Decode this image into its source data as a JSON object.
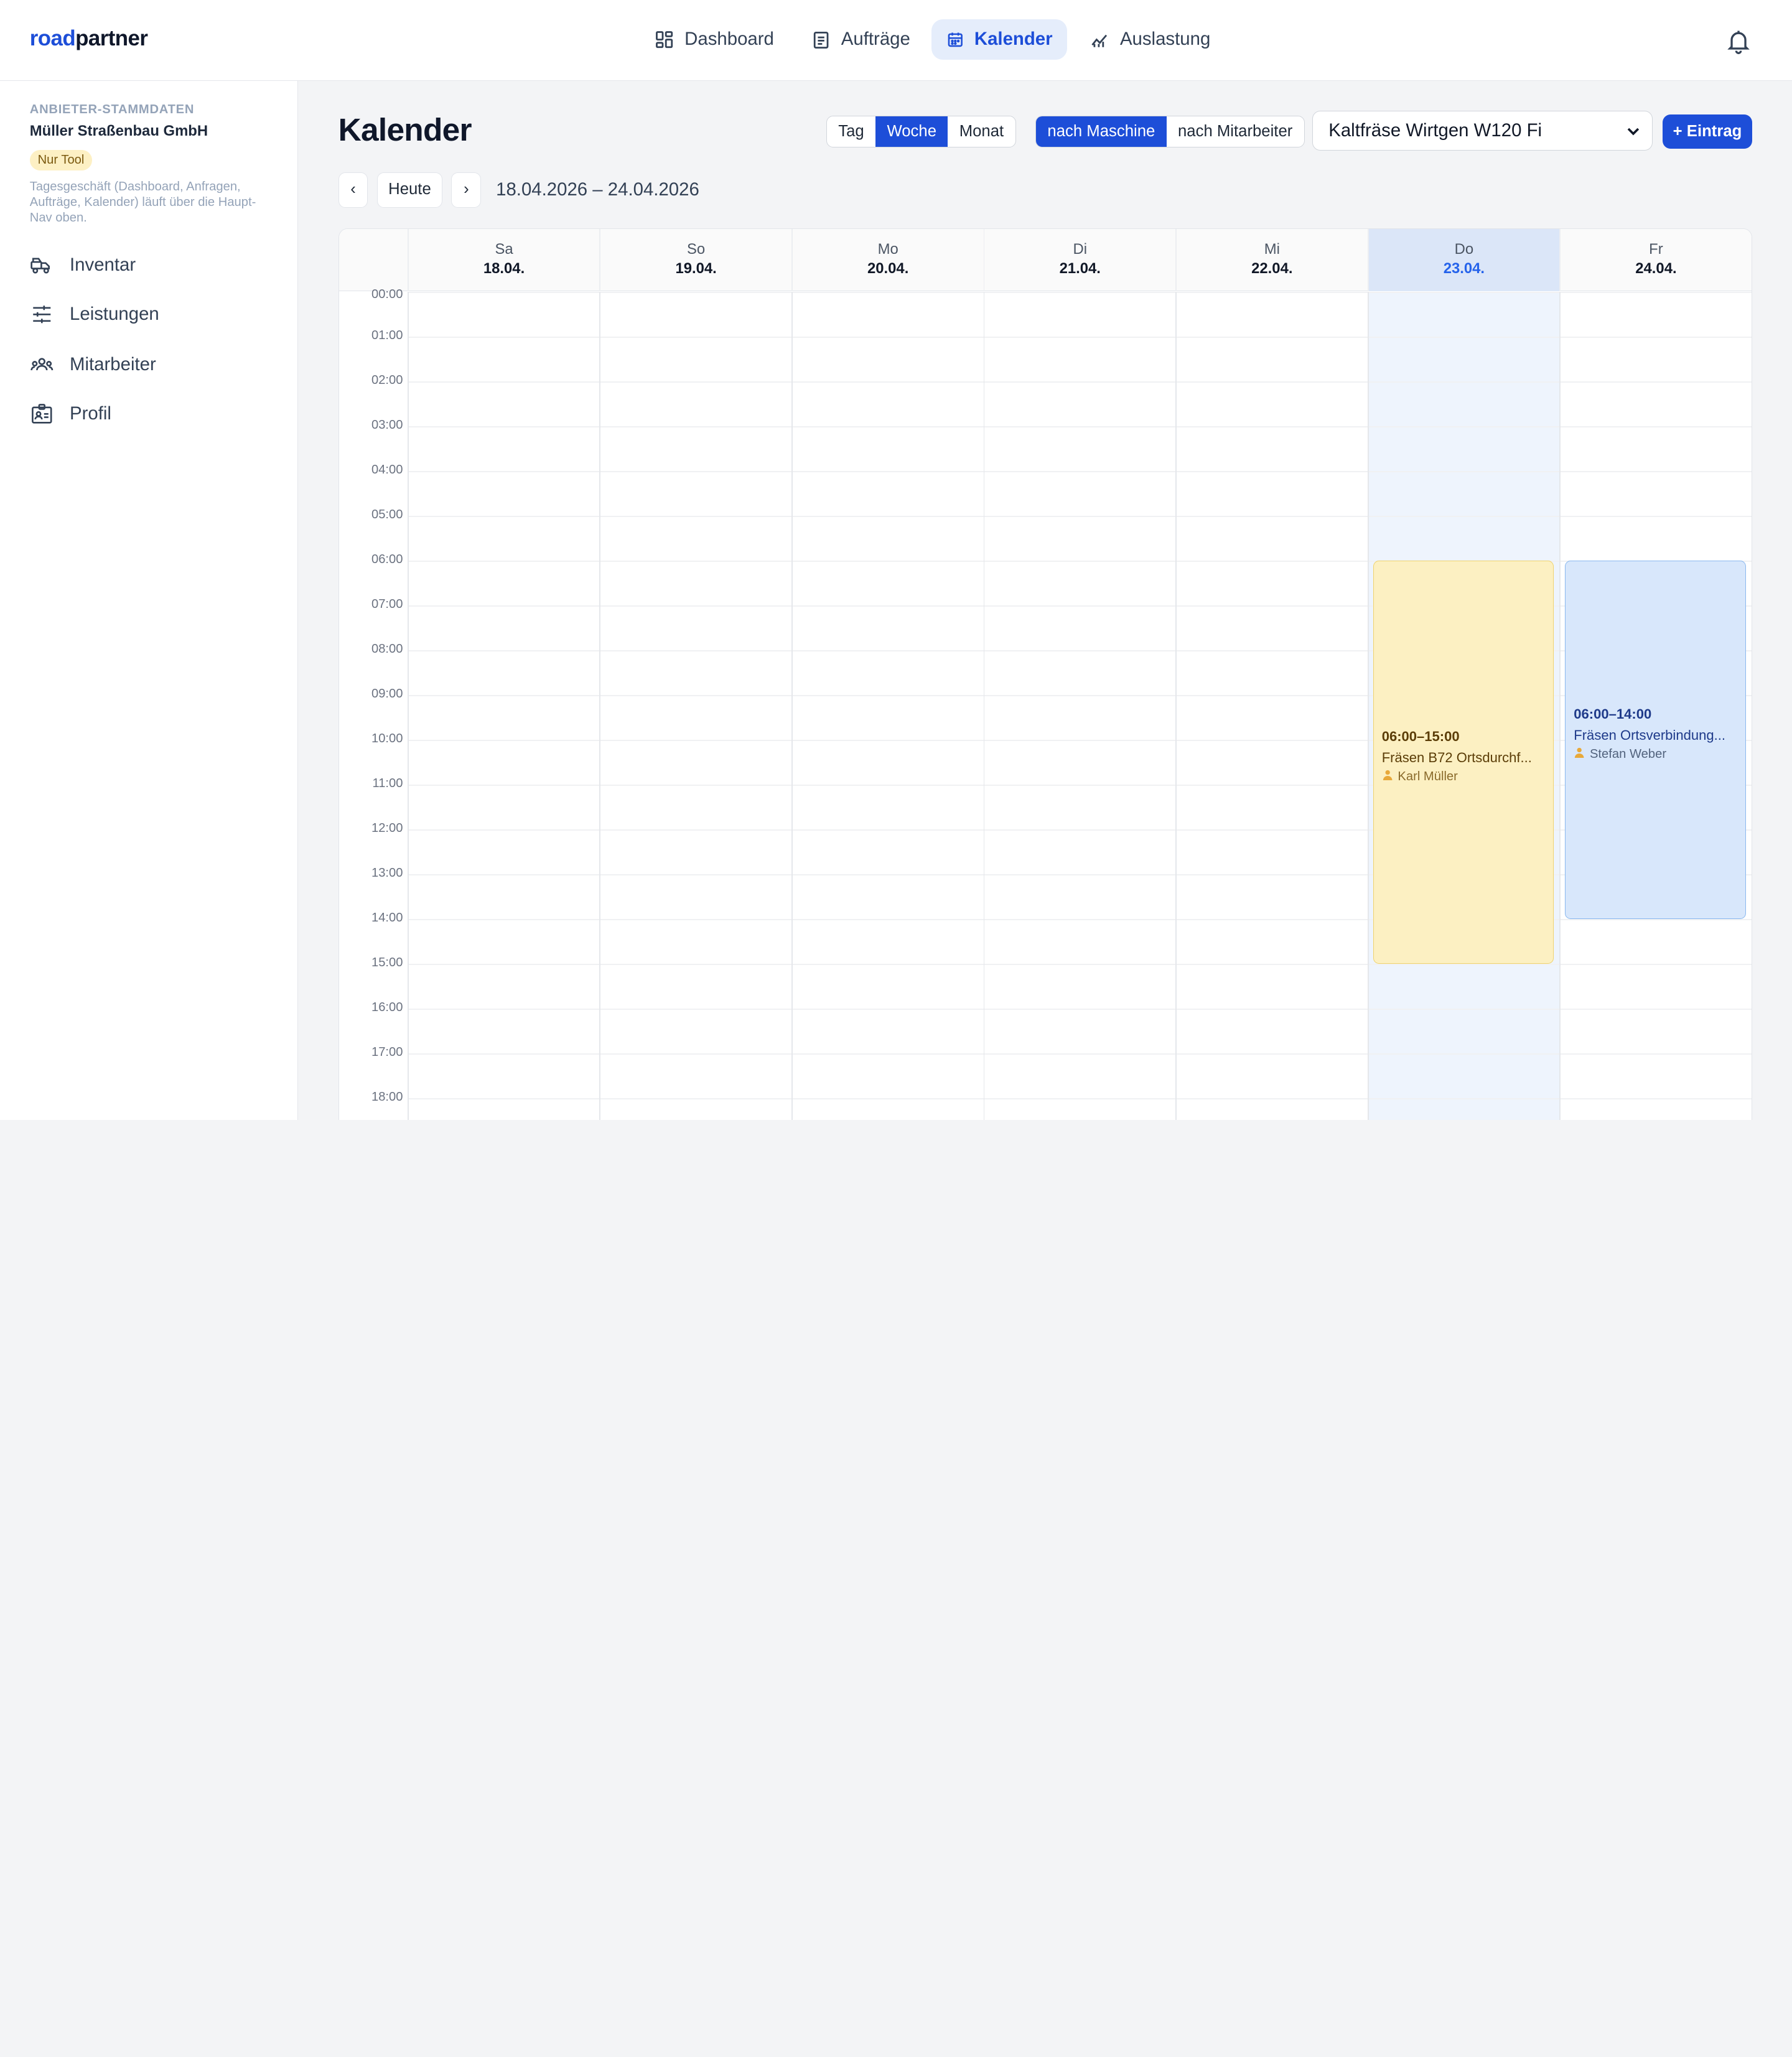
{
  "brand": {
    "part1": "road",
    "part2": "partner"
  },
  "nav": [
    {
      "label": "Dashboard",
      "icon": "dashboard-icon",
      "active": false
    },
    {
      "label": "Aufträge",
      "icon": "clipboard-icon",
      "active": false
    },
    {
      "label": "Kalender",
      "icon": "calendar-icon",
      "active": true
    },
    {
      "label": "Auslastung",
      "icon": "chart-icon",
      "active": false
    }
  ],
  "sidebar": {
    "section_label": "ANBIETER-STAMMDATEN",
    "company": "Müller Straßenbau GmbH",
    "badge": "Nur Tool",
    "note": "Tagesgeschäft (Dashboard, Anfragen, Aufträge, Kalender) läuft über die Haupt-Nav oben.",
    "items": [
      {
        "label": "Inventar",
        "icon": "truck-icon"
      },
      {
        "label": "Leistungen",
        "icon": "sliders-icon"
      },
      {
        "label": "Mitarbeiter",
        "icon": "team-icon"
      },
      {
        "label": "Profil",
        "icon": "id-card-icon"
      }
    ]
  },
  "page": {
    "title": "Kalender",
    "view_modes": [
      "Tag",
      "Woche",
      "Monat"
    ],
    "view_selected": "Woche",
    "group_modes": [
      "nach Maschine",
      "nach Mitarbeiter"
    ],
    "group_selected": "nach Maschine",
    "machine_select": "Kaltfräse Wirtgen W120 Fi",
    "add_button": "+ Eintrag",
    "prev": "‹",
    "today": "Heute",
    "next": "›",
    "range": "18.04.2026 – 24.04.2026"
  },
  "calendar": {
    "days": [
      {
        "name": "Sa",
        "date": "18.04.",
        "today": false
      },
      {
        "name": "So",
        "date": "19.04.",
        "today": false
      },
      {
        "name": "Mo",
        "date": "20.04.",
        "today": false
      },
      {
        "name": "Di",
        "date": "21.04.",
        "today": false
      },
      {
        "name": "Mi",
        "date": "22.04.",
        "today": false
      },
      {
        "name": "Do",
        "date": "23.04.",
        "today": true
      },
      {
        "name": "Fr",
        "date": "24.04.",
        "today": false
      }
    ],
    "hours": [
      "00:00",
      "01:00",
      "02:00",
      "03:00",
      "04:00",
      "05:00",
      "06:00",
      "07:00",
      "08:00",
      "09:00",
      "10:00",
      "11:00",
      "12:00",
      "13:00",
      "14:00",
      "15:00",
      "16:00",
      "17:00",
      "18:00"
    ],
    "events": [
      {
        "day": 5,
        "start": 6,
        "end": 15,
        "time": "06:00–15:00",
        "title": "Fräsen B72 Ortsdurchf...",
        "person": "Karl Müller",
        "color": "yellow"
      },
      {
        "day": 6,
        "start": 6,
        "end": 14,
        "time": "06:00–14:00",
        "title": "Fräsen Ortsverbindung...",
        "person": "Stefan Weber",
        "color": "blue"
      }
    ]
  }
}
